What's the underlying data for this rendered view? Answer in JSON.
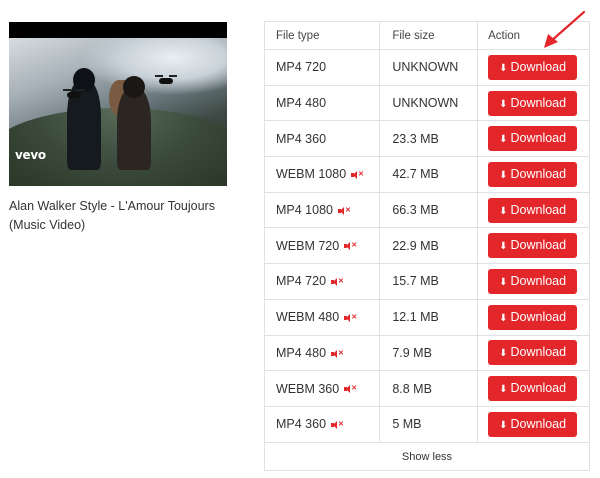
{
  "video": {
    "title": "Alan Walker Style - L'Amour Toujours (Music Video)",
    "watermark": "vevo"
  },
  "table": {
    "headers": [
      "File type",
      "File size",
      "Action"
    ],
    "rows": [
      {
        "type": "MP4 720",
        "size": "UNKNOWN",
        "muted": false,
        "action": "Download"
      },
      {
        "type": "MP4 480",
        "size": "UNKNOWN",
        "muted": false,
        "action": "Download"
      },
      {
        "type": "MP4 360",
        "size": "23.3 MB",
        "muted": false,
        "action": "Download"
      },
      {
        "type": "WEBM 1080",
        "size": "42.7 MB",
        "muted": true,
        "action": "Download"
      },
      {
        "type": "MP4 1080",
        "size": "66.3 MB",
        "muted": true,
        "action": "Download"
      },
      {
        "type": "WEBM 720",
        "size": "22.9 MB",
        "muted": true,
        "action": "Download"
      },
      {
        "type": "MP4 720",
        "size": "15.7 MB",
        "muted": true,
        "action": "Download"
      },
      {
        "type": "WEBM 480",
        "size": "12.1 MB",
        "muted": true,
        "action": "Download"
      },
      {
        "type": "MP4 480",
        "size": "7.9 MB",
        "muted": true,
        "action": "Download"
      },
      {
        "type": "WEBM 360",
        "size": "8.8 MB",
        "muted": true,
        "action": "Download"
      },
      {
        "type": "MP4 360",
        "size": "5 MB",
        "muted": true,
        "action": "Download"
      }
    ],
    "show_less_label": "Show less"
  },
  "icons": {
    "download": "download-arrow-icon",
    "muted": "muted-speaker-icon",
    "annotation": "red-pointer-arrow-icon"
  },
  "colors": {
    "accent": "#e3262a",
    "border": "#dee2e6"
  }
}
